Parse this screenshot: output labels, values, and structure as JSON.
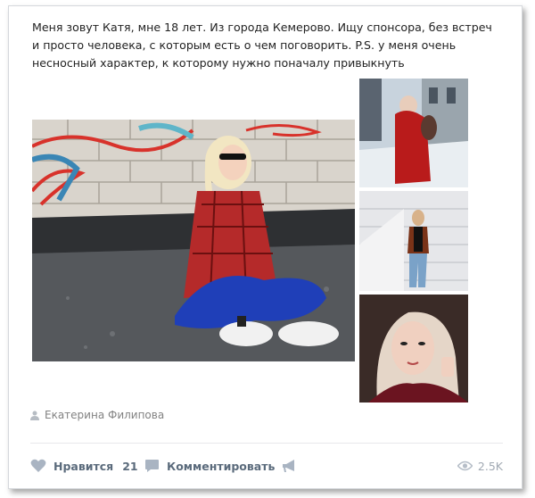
{
  "post": {
    "text": "Меня зовут Катя, мне 18 лет. Из города Кемерово. Ищу спонсора, без встреч и просто человека, с которым есть о чем поговорить. P.S. у меня очень несносный характер, к которому нужно поначалу привыкнуть",
    "author": "Екатерина Филипова"
  },
  "actions": {
    "like_label": "Нравится",
    "like_count": "21",
    "comment_label": "Комментировать",
    "views_count": "2.5K"
  },
  "icons": {
    "author": "person-icon",
    "like": "heart-icon",
    "comment": "comment-icon",
    "share": "megaphone-icon",
    "views": "eye-icon"
  },
  "colors": {
    "action_text": "#5b6b7c",
    "icon": "#a9b4c2",
    "meta_text": "#828282"
  }
}
